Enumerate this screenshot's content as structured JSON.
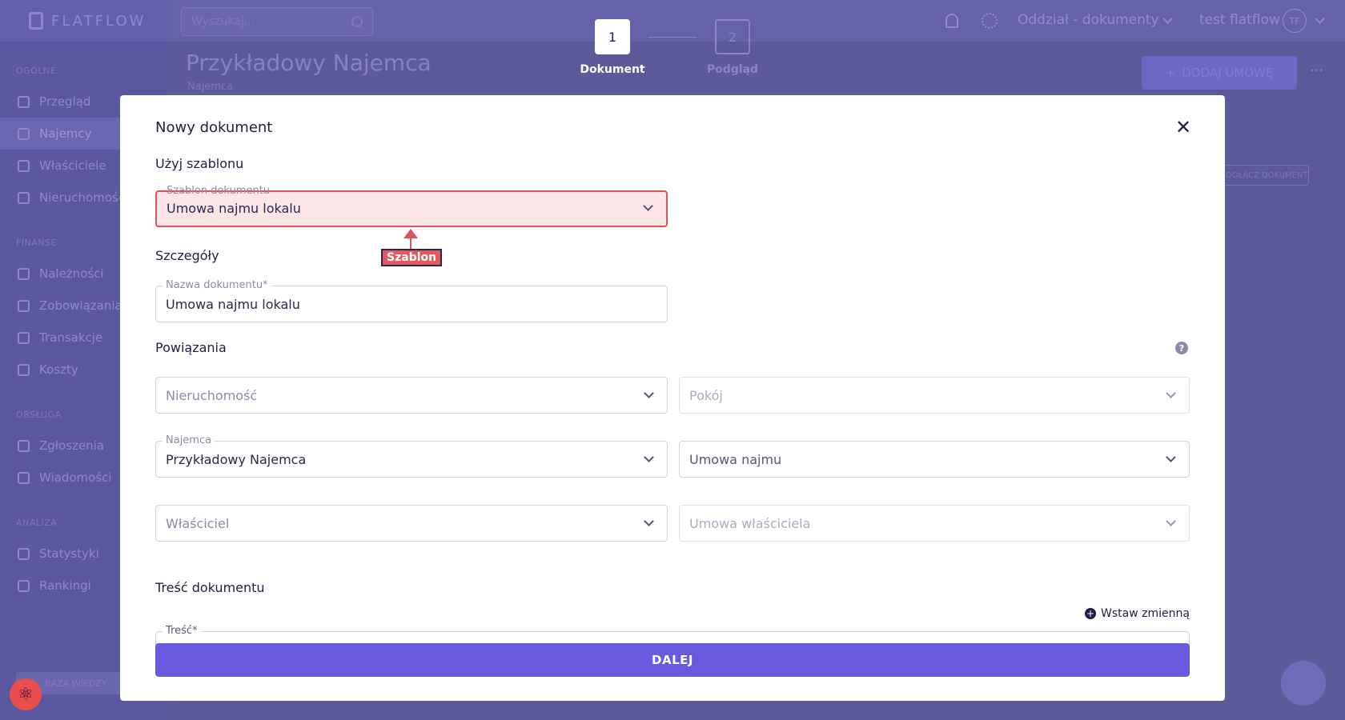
{
  "app": {
    "brand": "FLATFLOW",
    "search_placeholder": "Wyszukaj...",
    "branch": "Oddział - dokumenty",
    "user": "test flatflow",
    "avatar_initials": "TF"
  },
  "sidebar": {
    "sections": [
      {
        "title": "OGÓLNE",
        "items": [
          "Przegląd",
          "Najemcy",
          "Właściciele",
          "Nieruchomości"
        ]
      },
      {
        "title": "FINANSE",
        "items": [
          "Należności",
          "Zobowiązania",
          "Transakcje",
          "Koszty"
        ]
      },
      {
        "title": "OBSŁUGA",
        "items": [
          "Zgłoszenia",
          "Wiadomości"
        ]
      },
      {
        "title": "ANALIZA",
        "items": [
          "Statystyki",
          "Rankingi"
        ]
      }
    ],
    "knowledge_base": "BAZA WIEDZY"
  },
  "page": {
    "title": "Przykładowy Najemca",
    "subtitle": "Najemca",
    "add_contract": "DODAJ UMOWĘ",
    "attach_document": "DOŁĄCZ DOKUMENT"
  },
  "stepper": {
    "steps": [
      {
        "number": "1",
        "label": "Dokument",
        "active": true
      },
      {
        "number": "2",
        "label": "Podgląd",
        "active": false
      }
    ]
  },
  "modal": {
    "title": "Nowy dokument",
    "use_template_heading": "Użyj szablonu",
    "template_field": {
      "legend": "Szablon dokumentu",
      "value": "Umowa najmu lokalu"
    },
    "annotation_label": "Szablon",
    "details_heading": "Szczegóły",
    "name_field": {
      "legend": "Nazwa dokumentu*",
      "value": "Umowa najmu lokalu"
    },
    "links_heading": "Powiązania",
    "links": {
      "property": {
        "placeholder": "Nieruchomość"
      },
      "room": {
        "placeholder": "Pokój"
      },
      "tenant": {
        "legend": "Najemca",
        "value": "Przykładowy Najemca"
      },
      "lease": {
        "placeholder": "Umowa najmu"
      },
      "owner": {
        "placeholder": "Właściciel"
      },
      "owner_contract": {
        "placeholder": "Umowa właściciela"
      }
    },
    "content_heading": "Treść dokumentu",
    "insert_variable": "Wstaw zmienną",
    "content_legend": "Treść*",
    "next_button": "DALEJ"
  },
  "colors": {
    "accent": "#6a5ae0",
    "highlight_border": "#e0525a",
    "highlight_fill": "#fbe5e6",
    "overlay": "#5d5a9a"
  }
}
